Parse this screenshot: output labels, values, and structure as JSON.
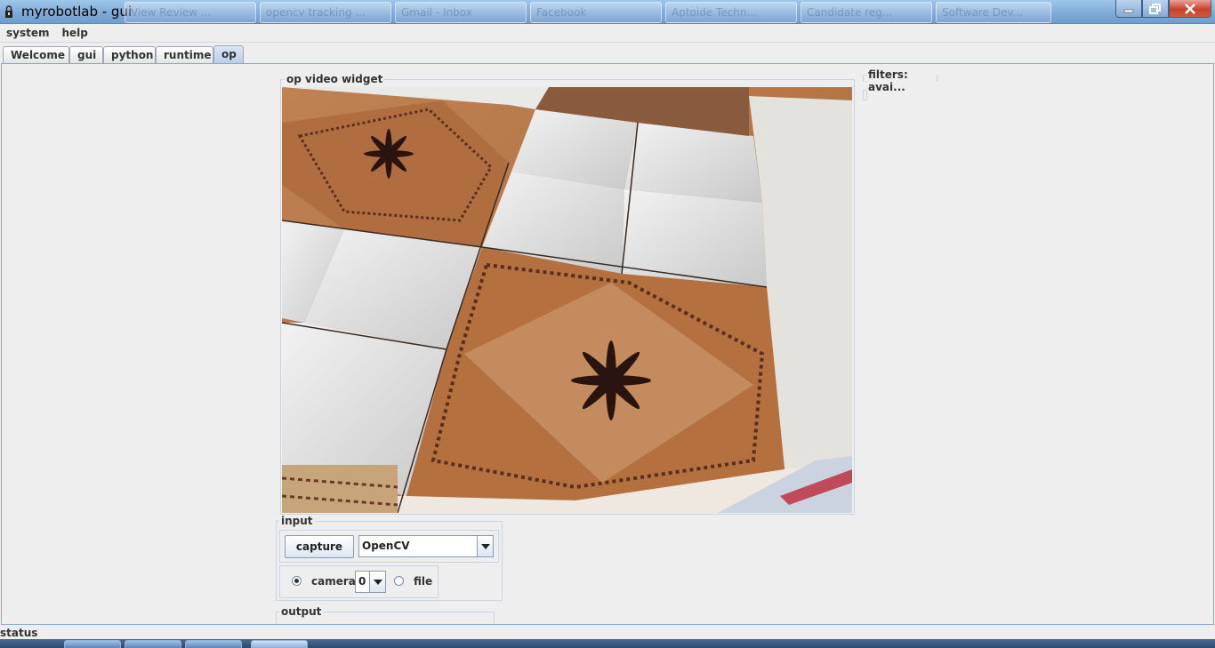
{
  "window": {
    "title": "myrobotlab - gui",
    "background_tabs": [
      "View Review ...",
      "opencv tracking ...",
      "Gmail - Inbox",
      "Facebook",
      "Aptoide Techn...",
      "Candidate reg...",
      "Software Dev..."
    ]
  },
  "menu": [
    "system",
    "help"
  ],
  "tabs": [
    {
      "label": "Welcome",
      "active": false
    },
    {
      "label": "gui",
      "active": false
    },
    {
      "label": "python",
      "active": false
    },
    {
      "label": "runtime",
      "active": false
    },
    {
      "label": "op",
      "active": true
    }
  ],
  "video_widget": {
    "title": "op  video widget"
  },
  "filters": {
    "title": "filters: avai..."
  },
  "input": {
    "title": "input",
    "capture_label": "capture",
    "source_value": "OpenCV",
    "camera_label": "camera",
    "camera_index": "0",
    "file_label": "file",
    "selected_source": "camera"
  },
  "output": {
    "title": "output"
  },
  "status": {
    "label": "status"
  },
  "colors": {
    "accent": "#b8cfe9",
    "border": "#8ea8cb"
  }
}
